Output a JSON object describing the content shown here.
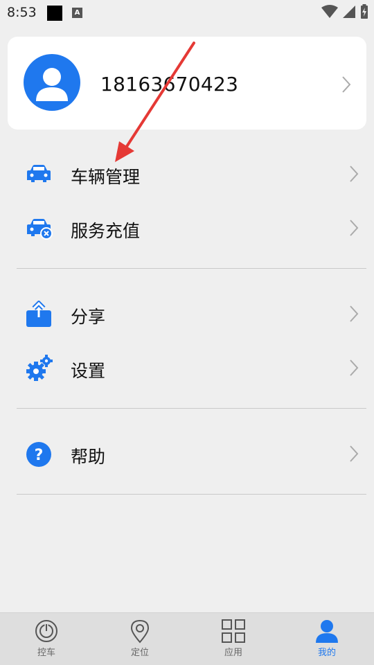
{
  "status_bar": {
    "time": "8:53",
    "badge": "A"
  },
  "profile": {
    "phone": "18163670423"
  },
  "menu": {
    "vehicle_management": "车辆管理",
    "service_recharge": "服务充值",
    "share": "分享",
    "settings": "设置",
    "help": "帮助"
  },
  "bottom_nav": {
    "control": "控车",
    "location": "定位",
    "apps": "应用",
    "mine": "我的"
  },
  "colors": {
    "accent": "#1f78ee",
    "annotation": "#e53935"
  }
}
